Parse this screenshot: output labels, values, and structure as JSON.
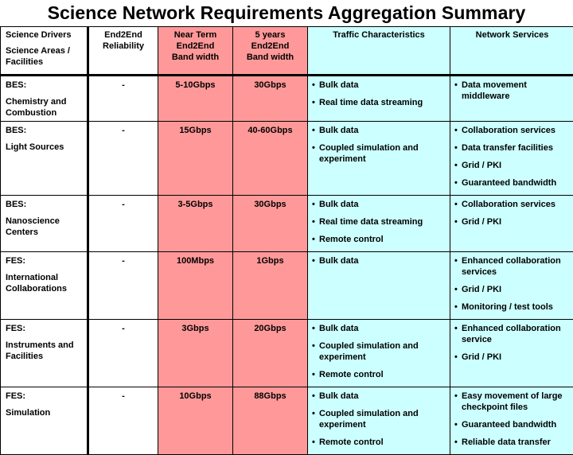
{
  "title": "Science Network Requirements Aggregation Summary",
  "colors": {
    "bandwidth_columns": "#ff9999",
    "traffic_services_columns": "#ccffff",
    "driver_columns": "#ffffff",
    "border": "#000000"
  },
  "header": {
    "drivers": [
      "Science Drivers",
      "Science Areas / Facilities"
    ],
    "reliability": [
      "End2End",
      "Reliability"
    ],
    "near_term": [
      "Near Term",
      "End2End",
      "Band width"
    ],
    "five_years": [
      "5 years",
      "End2End",
      "Band width"
    ],
    "traffic": "Traffic Characteristics",
    "services": "Network Services"
  },
  "bullet": "•",
  "rows": [
    {
      "office": "BES:",
      "area": "Chemistry and Combustion",
      "reliability": "-",
      "near_term": "5-10Gbps",
      "five_years": "30Gbps",
      "traffic": [
        "Bulk data",
        "Real time data streaming"
      ],
      "services": [
        "Data movement middleware"
      ]
    },
    {
      "office": "BES:",
      "area": "Light Sources",
      "reliability": "-",
      "near_term": "15Gbps",
      "five_years": "40-60Gbps",
      "traffic": [
        "Bulk data",
        "Coupled simulation and experiment"
      ],
      "services": [
        "Collaboration services",
        "Data transfer facilities",
        "Grid / PKI",
        "Guaranteed bandwidth"
      ]
    },
    {
      "office": "BES:",
      "area": "Nanoscience Centers",
      "reliability": "-",
      "near_term": "3-5Gbps",
      "five_years": "30Gbps",
      "traffic": [
        "Bulk data",
        "Real time data streaming",
        "Remote control"
      ],
      "services": [
        "Collaboration services",
        "Grid / PKI"
      ]
    },
    {
      "office": "FES:",
      "area": "International Collaborations",
      "reliability": "-",
      "near_term": "100Mbps",
      "five_years": "1Gbps",
      "traffic": [
        "Bulk data"
      ],
      "services": [
        "Enhanced collaboration services",
        "Grid / PKI",
        "Monitoring / test tools"
      ]
    },
    {
      "office": "FES:",
      "area": "Instruments and Facilities",
      "reliability": "-",
      "near_term": "3Gbps",
      "five_years": "20Gbps",
      "traffic": [
        "Bulk data",
        "Coupled simulation and experiment",
        "Remote control"
      ],
      "services": [
        "Enhanced collaboration service",
        "Grid / PKI"
      ]
    },
    {
      "office": "FES:",
      "area": "Simulation",
      "reliability": "-",
      "near_term": "10Gbps",
      "five_years": "88Gbps",
      "traffic": [
        "Bulk data",
        "Coupled simulation and experiment",
        "Remote control"
      ],
      "services": [
        "Easy movement of large checkpoint files",
        "Guaranteed bandwidth",
        "Reliable data transfer"
      ]
    }
  ]
}
